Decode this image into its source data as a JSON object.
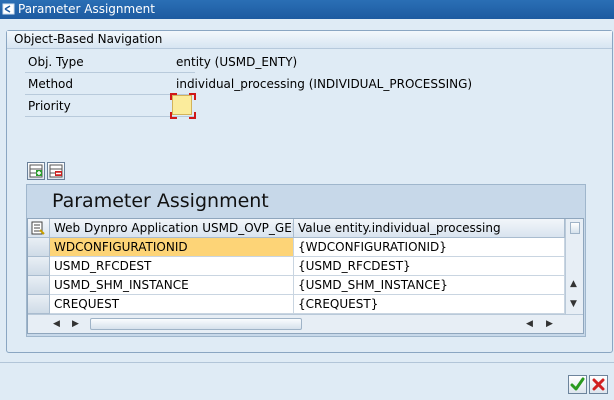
{
  "window": {
    "title": "Parameter Assignment"
  },
  "group": {
    "header": "Object-Based Navigation"
  },
  "form": {
    "obj_type_label": "Obj. Type",
    "obj_type_value": "entity (USMD_ENTY)",
    "method_label": "Method",
    "method_value": "individual_processing (INDIVIDUAL_PROCESSING)",
    "priority_label": "Priority",
    "priority_value": ""
  },
  "table": {
    "title": "Parameter Assignment",
    "columns": [
      "Web Dynpro Application USMD_OVP_GEN",
      "Value entity.individual_processing"
    ],
    "rows": [
      [
        "WDCONFIGURATIONID",
        "{WDCONFIGURATIONID}"
      ],
      [
        "USMD_RFCDEST",
        "{USMD_RFCDEST}"
      ],
      [
        "USMD_SHM_INSTANCE",
        "{USMD_SHM_INSTANCE}"
      ],
      [
        "CREQUEST",
        "{CREQUEST}"
      ]
    ]
  },
  "toolbar": {
    "icons": [
      "insert-row-icon",
      "delete-row-icon"
    ]
  },
  "footer": {
    "icons": [
      "confirm-icon",
      "cancel-icon"
    ]
  },
  "colors": {
    "title_bar": "#1d5aa0",
    "background": "#dfebf5",
    "highlight_cell": "#fdd477",
    "priority_field": "#fbec9c"
  }
}
